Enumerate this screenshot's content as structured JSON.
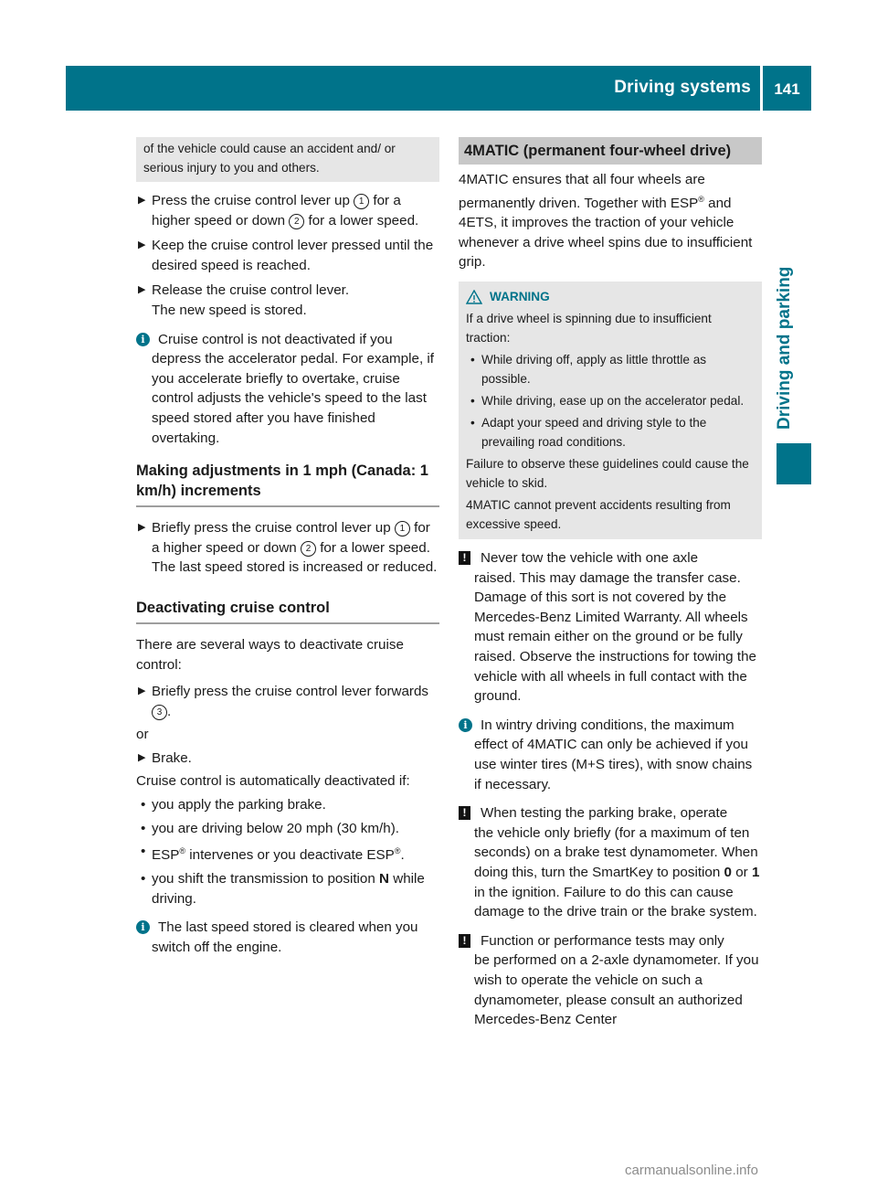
{
  "header": {
    "title": "Driving systems",
    "page_number": "141"
  },
  "side_tab": {
    "label": "Driving and parking"
  },
  "left_column": {
    "warning_continuation": "of the vehicle could cause an accident and/ or serious injury to you and others.",
    "steps_1": [
      {
        "pre": "Press the cruise control lever up ",
        "n1": "1",
        "mid": " for a higher speed or down ",
        "n2": "2",
        "post": " for a lower speed."
      },
      {
        "text": "Keep the cruise control lever pressed until the desired speed is reached."
      },
      {
        "line1": "Release the cruise control lever.",
        "line2": "The new speed is stored."
      }
    ],
    "info_1": {
      "first": "Cruise control is not deactivated if you",
      "rest": "depress the accelerator pedal. For example, if you accelerate briefly to overtake, cruise control adjusts the vehicle's speed to the last speed stored after you have finished overtaking."
    },
    "heading_1": "Making adjustments in 1 mph (Canada: 1 km/h) increments",
    "step_2": {
      "pre": "Briefly press the cruise control lever up ",
      "n1": "1",
      "mid": " for a higher speed or down ",
      "n2": "2",
      "post": " for a lower speed.",
      "line2": "The last speed stored is increased or reduced."
    },
    "heading_2": "Deactivating cruise control",
    "intro": "There are several ways to deactivate cruise control:",
    "step_3": {
      "pre": "Briefly press the cruise control lever forwards ",
      "n3": "3",
      "post": "."
    },
    "or": "or",
    "step_4": "Brake.",
    "auto_intro": "Cruise control is automatically deactivated if:",
    "bullets": [
      "you apply the parking brake.",
      "you are driving below 20 mph (30 km/h).",
      {
        "a": "ESP",
        "b": " intervenes or you deactivate ESP",
        "c": "."
      },
      {
        "pre": "you shift the transmission to position ",
        "bold": "N",
        "post": " while driving."
      }
    ],
    "info_2": {
      "first": "The last speed stored is cleared when you",
      "rest": "switch off the engine."
    }
  },
  "right_column": {
    "section_title": "4MATIC (permanent four-wheel drive)",
    "intro": {
      "a": "4MATIC ensures that all four wheels are permanently driven. Together with ESP",
      "b": " and 4ETS, it improves the traction of your vehicle whenever a drive wheel spins due to insufficient grip."
    },
    "warning": {
      "title": "WARNING",
      "lead": "If a drive wheel is spinning due to insufficient traction:",
      "bullets": [
        "While driving off, apply as little throttle as possible.",
        "While driving, ease up on the accelerator pedal.",
        "Adapt your speed and driving style to the prevailing road conditions."
      ],
      "p1": "Failure to observe these guidelines could cause the vehicle to skid.",
      "p2": "4MATIC cannot prevent accidents resulting from excessive speed."
    },
    "note_1": {
      "first": "Never tow the vehicle with one axle",
      "rest": "raised. This may damage the transfer case. Damage of this sort is not covered by the Mercedes-Benz Limited Warranty. All wheels must remain either on the ground or be fully raised. Observe the instructions for towing the vehicle with all wheels in full contact with the ground."
    },
    "info_1": {
      "first": "In wintry driving conditions, the maximum",
      "rest": "effect of 4MATIC can only be achieved if you use winter tires (M+S tires), with snow chains if necessary."
    },
    "note_2": {
      "first": "When testing the parking brake, operate",
      "rest_a": "the vehicle only briefly (for a maximum of ten seconds) on a brake test dynamometer. When doing this, turn the SmartKey to position ",
      "b0": "0",
      "or": " or ",
      "b1": "1",
      "rest_b": " in the ignition. Failure to do this can cause damage to the drive train or the brake system."
    },
    "note_3": {
      "first": "Function or performance tests may only",
      "rest": "be performed on a 2-axle dynamometer. If you wish to operate the vehicle on such a dynamometer, please consult an authorized Mercedes-Benz Center"
    }
  },
  "icons": {
    "step": "▶",
    "info": "i",
    "note": "!",
    "bullet": "•",
    "registered": "®"
  },
  "watermark": "carmanualsonline.info",
  "colors": {
    "brand": "#00738a",
    "box_grey": "#e6e6e6",
    "section_grey": "#c8c8c8"
  }
}
